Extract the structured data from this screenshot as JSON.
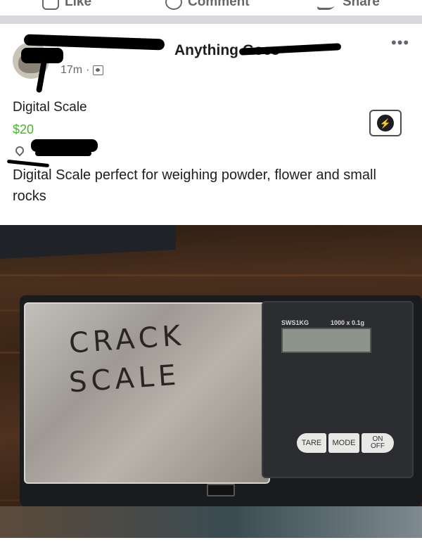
{
  "top_actions": {
    "like_label": "Like",
    "comment_label": "Comment",
    "share_label": "Share"
  },
  "post": {
    "group_name": "Anything Goes",
    "time_ago": "17m",
    "separator": "·",
    "more_label": "•••",
    "item_title": "Digital Scale",
    "price": "$20",
    "description": "Digital Scale perfect for weighing powder, flower and small rocks",
    "messenger_icon": "messenger-icon"
  },
  "photo": {
    "handwritten_line1": "CRACK",
    "handwritten_line2": "SCALE",
    "model": "SWS1KG",
    "capacity": "1000 x 0.1g",
    "key_tare": "TARE",
    "key_mode": "MODE",
    "key_on": "ON",
    "key_off": "OFF"
  },
  "colors": {
    "price_green": "#42b72a",
    "secondary_text": "#65676b",
    "divider": "#d7d9dd"
  }
}
